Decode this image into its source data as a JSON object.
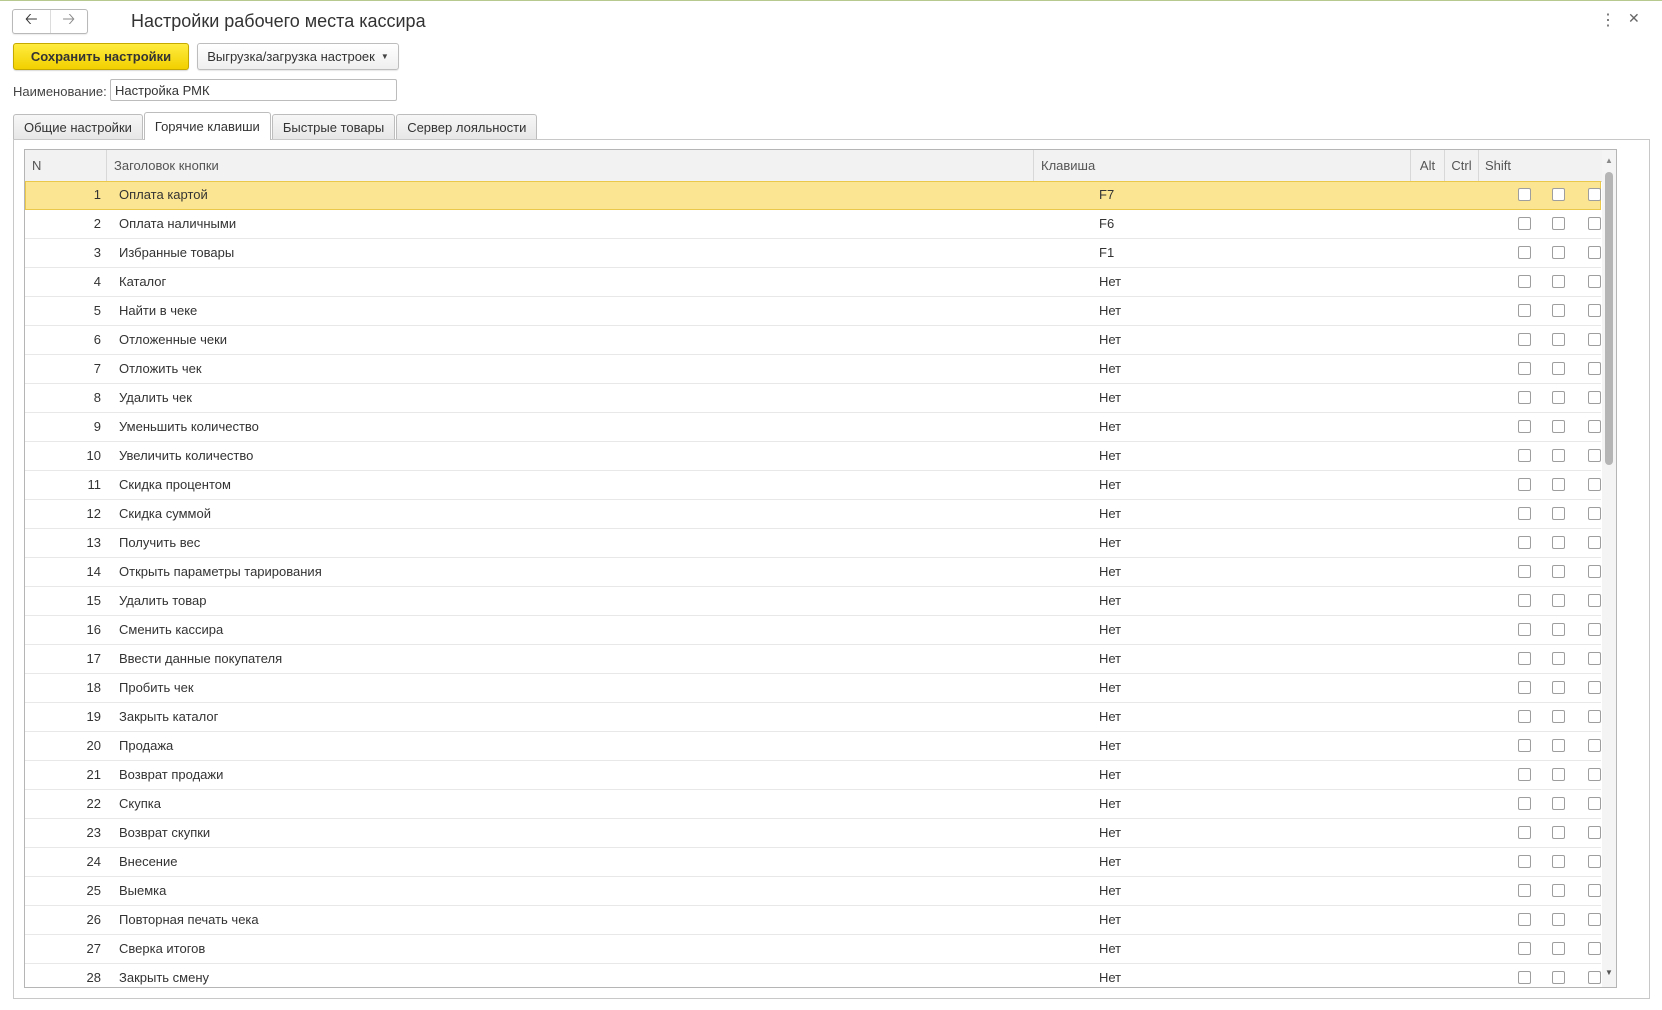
{
  "header": {
    "back_icon": "arrow-left-icon",
    "forward_icon": "arrow-right-icon",
    "title": "Настройки рабочего места кассира",
    "more_icon": "kebab-menu-icon",
    "close_icon": "close-icon"
  },
  "toolbar": {
    "save_label": "Сохранить настройки",
    "export_label": "Выгрузка/загрузка настроек"
  },
  "name_field": {
    "label": "Наименование:",
    "value": "Настройка РМК"
  },
  "tabs": [
    {
      "label": "Общие настройки",
      "active": false
    },
    {
      "label": "Горячие клавиши",
      "active": true
    },
    {
      "label": "Быстрые товары",
      "active": false
    },
    {
      "label": "Сервер лояльности",
      "active": false
    }
  ],
  "table": {
    "columns": {
      "n": "N",
      "title": "Заголовок кнопки",
      "key": "Клавиша",
      "alt": "Alt",
      "ctrl": "Ctrl",
      "shift": "Shift"
    },
    "selected_row": 1,
    "rows": [
      {
        "n": "1",
        "title": "Оплата картой",
        "key": "F7"
      },
      {
        "n": "2",
        "title": "Оплата наличными",
        "key": "F6"
      },
      {
        "n": "3",
        "title": "Избранные товары",
        "key": "F1"
      },
      {
        "n": "4",
        "title": "Каталог",
        "key": "Нет"
      },
      {
        "n": "5",
        "title": "Найти в чеке",
        "key": "Нет"
      },
      {
        "n": "6",
        "title": "Отложенные чеки",
        "key": "Нет"
      },
      {
        "n": "7",
        "title": "Отложить чек",
        "key": "Нет"
      },
      {
        "n": "8",
        "title": "Удалить чек",
        "key": "Нет"
      },
      {
        "n": "9",
        "title": "Уменьшить количество",
        "key": "Нет"
      },
      {
        "n": "10",
        "title": "Увеличить количество",
        "key": "Нет"
      },
      {
        "n": "11",
        "title": "Скидка процентом",
        "key": "Нет"
      },
      {
        "n": "12",
        "title": "Скидка суммой",
        "key": "Нет"
      },
      {
        "n": "13",
        "title": "Получить вес",
        "key": "Нет"
      },
      {
        "n": "14",
        "title": "Открыть параметры тарирования",
        "key": "Нет"
      },
      {
        "n": "15",
        "title": "Удалить товар",
        "key": "Нет"
      },
      {
        "n": "16",
        "title": "Сменить кассира",
        "key": "Нет"
      },
      {
        "n": "17",
        "title": "Ввести данные покупателя",
        "key": "Нет"
      },
      {
        "n": "18",
        "title": "Пробить чек",
        "key": "Нет"
      },
      {
        "n": "19",
        "title": "Закрыть каталог",
        "key": "Нет"
      },
      {
        "n": "20",
        "title": "Продажа",
        "key": "Нет"
      },
      {
        "n": "21",
        "title": "Возврат продажи",
        "key": "Нет"
      },
      {
        "n": "22",
        "title": "Скупка",
        "key": "Нет"
      },
      {
        "n": "23",
        "title": "Возврат скупки",
        "key": "Нет"
      },
      {
        "n": "24",
        "title": "Внесение",
        "key": "Нет"
      },
      {
        "n": "25",
        "title": "Выемка",
        "key": "Нет"
      },
      {
        "n": "26",
        "title": "Повторная печать чека",
        "key": "Нет"
      },
      {
        "n": "27",
        "title": "Сверка итогов",
        "key": "Нет"
      },
      {
        "n": "28",
        "title": "Закрыть смену",
        "key": "Нет"
      }
    ]
  },
  "colors": {
    "save_button": "#f5d800",
    "selected_row": "#fbe592"
  }
}
